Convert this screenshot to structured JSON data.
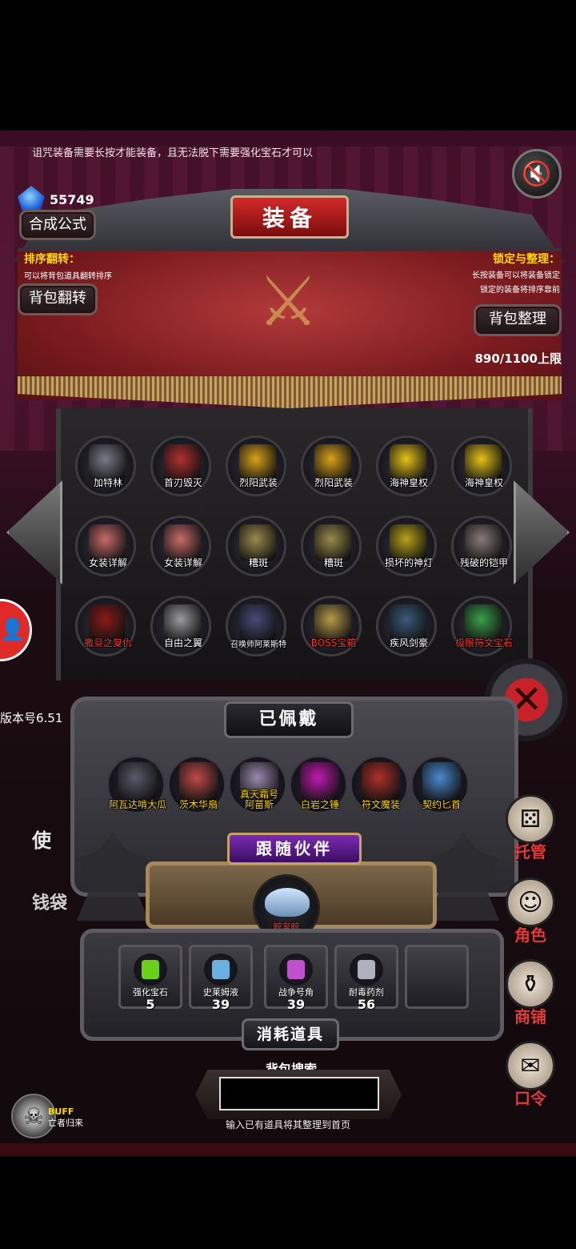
{
  "notice": "诅咒装备需要长按才能装备，且无法脱下需要强化宝石才可以",
  "gem_count": "55749",
  "title": "装备",
  "buttons": {
    "synthesis": "合成公式",
    "flip_bag": "背包翻转",
    "sort_bag": "背包整理"
  },
  "info_left": {
    "heading": "排序翻转：",
    "desc": "可以将背包道具翻转排序"
  },
  "info_right": {
    "heading": "锁定与整理：",
    "desc1": "长按装备可以将装备锁定",
    "desc2": "锁定的装备将排序靠前"
  },
  "capacity": "890/1100上限",
  "inventory": [
    {
      "label": "加特林",
      "color": "#7a7a8a",
      "red": false
    },
    {
      "label": "首刃毁灭",
      "color": "#b03030",
      "red": false
    },
    {
      "label": "烈阳武装",
      "color": "#d9a21a",
      "red": false
    },
    {
      "label": "烈阳武装",
      "color": "#d9a21a",
      "red": false
    },
    {
      "label": "海神皇权",
      "color": "#e6c21a",
      "red": false
    },
    {
      "label": "海神皇权",
      "color": "#e6c21a",
      "red": false
    },
    {
      "label": "女装详解",
      "color": "#c96a6a",
      "red": false
    },
    {
      "label": "女装详解",
      "color": "#c96a6a",
      "red": false
    },
    {
      "label": "糟斑",
      "color": "#9a8a4a",
      "red": false
    },
    {
      "label": "糟斑",
      "color": "#9a8a4a",
      "red": false
    },
    {
      "label": "损坏的神灯",
      "color": "#b8a21a",
      "red": false
    },
    {
      "label": "残破的铠甲",
      "color": "#8a7a7a",
      "red": false
    },
    {
      "label": "撒旦之复仇",
      "color": "#8a1a1a",
      "red": true
    },
    {
      "label": "自由之翼",
      "color": "#9a9aa0",
      "red": false
    },
    {
      "label": "召唤师阿莱斯特",
      "color": "#4a4a7a",
      "red": false,
      "tiny": true
    },
    {
      "label": "BOSS宝箱",
      "color": "#b89a4a",
      "red": true
    },
    {
      "label": "疾风剑豪",
      "color": "#3a5a7a",
      "red": false
    },
    {
      "label": "极限符文宝石",
      "color": "#3aa04a",
      "red": true
    }
  ],
  "equipped_title": "已佩戴",
  "equipped": [
    {
      "label": "阿瓦达啃大瓜",
      "color": "#5a5a6a"
    },
    {
      "label": "茨木华扇",
      "color": "#c04a4a"
    },
    {
      "label": "真天霜号\n阿苗斯",
      "color": "#9a8ab0"
    },
    {
      "label": "白岩之锤",
      "color": "#c01ab0"
    },
    {
      "label": "符文魔装",
      "color": "#b0302a"
    },
    {
      "label": "契约匕首",
      "color": "#4a8ad0"
    }
  ],
  "companion_title": "跟随伙伴",
  "companion": {
    "label": "鲸玺鲸"
  },
  "consumables_title": "消耗道具",
  "consumables": [
    {
      "label": "强化宝石",
      "count": "5",
      "color": "#6ad01a"
    },
    {
      "label": "史莱姆液",
      "count": "39",
      "color": "#6ab0e0"
    },
    {
      "label": "战争号角",
      "count": "39",
      "color": "#c050d0"
    },
    {
      "label": "耐毒药剂",
      "count": "56",
      "color": "#b0b0c0"
    }
  ],
  "search": {
    "label": "背包搜索",
    "placeholder": "",
    "hint": "输入已有道具将其整理到首页"
  },
  "version": "版本号6.51",
  "side_menu": [
    {
      "label": "托管",
      "icon": "⚄"
    },
    {
      "label": "角色",
      "icon": "☺"
    },
    {
      "label": "商铺",
      "icon": "⚱"
    },
    {
      "label": "口令",
      "icon": "✉"
    }
  ],
  "left_ghost": {
    "use": "使",
    "wallet": "钱袋"
  },
  "buff": {
    "title": "BUFF",
    "sub": "亡者归来"
  }
}
